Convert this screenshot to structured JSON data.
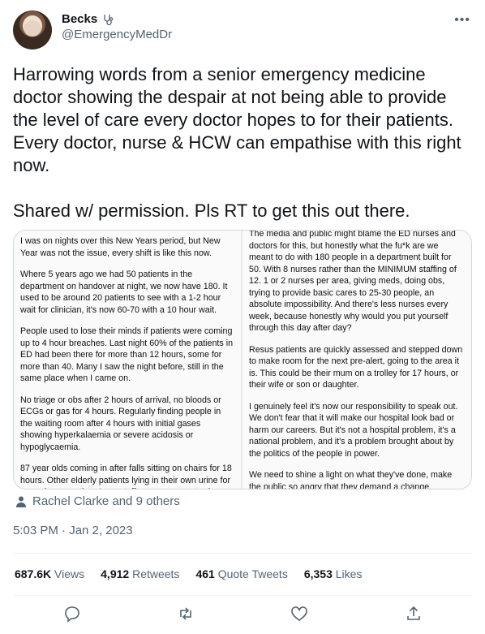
{
  "author": {
    "name": "Becks",
    "handle": "@EmergencyMedDr"
  },
  "tweet": {
    "paragraphs": [
      "Harrowing words from a senior emergency medicine doctor showing the despair at not being able to provide the level of care every doctor hopes to for their patients. Every doctor, nurse & HCW can empathise with this right now.",
      "Shared w/ permission. Pls RT to get this out there."
    ]
  },
  "media": {
    "left_paragraphs": [
      "I was on nights over this New Years period, but New Year was not the issue, every shift is like this now.",
      "Where 5 years ago we had 50 patients in the department on handover at night, we now have 180. It used to be around 20 patients to see with a 1-2 hour wait for clinician, it's now 60-70 with a 10 hour wait.",
      "People used to lose their minds if patients were coming up to 4 hour breaches. Last night 60% of the patients in ED had been there for more than 12 hours, some for more than 40. Many I saw the night before, still in the same place when I came on.",
      "No triage or obs after 2 hours of arrival, no bloods or ECGs or gas for 4 hours. Regularly finding people in the waiting room after 4 hours with initial gases showing hyperkalaemia or severe acidosis or hypoglycaemia.",
      "87 year olds coming in after falls sitting on chairs for 18 hours. Other elderly patients lying in their own urine for hours because there's no staff, or even room to change them into something dry. As the reg in charge of the"
    ],
    "right_paragraphs": [
      "The media and public might blame the ED nurses and doctors for this, but honestly what the fu*k are we meant to do with 180 people in a department built for 50. With 8 nurses rather than the MINIMUM staffing of 12. 1 or 2 nurses per area, giving meds, doing obs, trying to provide basic cares to 25-30 people, an absolute impossibility. And there's less nurses every week, because honestly why would you put yourself through this day after day?",
      "Resus patients are quickly assessed and stepped down to make room for the next pre-alert, going to the area it is. This could be their mum on a trolley for 17 hours, or their wife or son or daughter.",
      "I genuinely feel it's now our responsibility to speak out. We don't fear that it will make our hospital look bad or harm our careers. But it's not a hospital problem, it's a national problem, and it's a problem brought about by the politics of the people in power.",
      "We need to shine a light on what they've done, make the public so angry that they demand a change. Massive recruitment of nurses through a proper wage/paid uni/"
    ]
  },
  "tagged": "Rachel Clarke and 9 others",
  "timestamp": "5:03 PM · Jan 2, 2023",
  "stats": [
    {
      "value": "687.6K",
      "label": "Views"
    },
    {
      "value": "4,912",
      "label": "Retweets"
    },
    {
      "value": "461",
      "label": "Quote Tweets"
    },
    {
      "value": "6,353",
      "label": "Likes"
    }
  ],
  "icons": {
    "more": "more-icon",
    "stethoscope": "stethoscope-icon",
    "person": "person-icon",
    "reply": "reply-icon",
    "retweet": "retweet-icon",
    "like": "like-icon",
    "share": "share-icon"
  },
  "colors": {
    "text": "#0f1419",
    "secondary": "#536471",
    "border": "#cfd9de"
  }
}
